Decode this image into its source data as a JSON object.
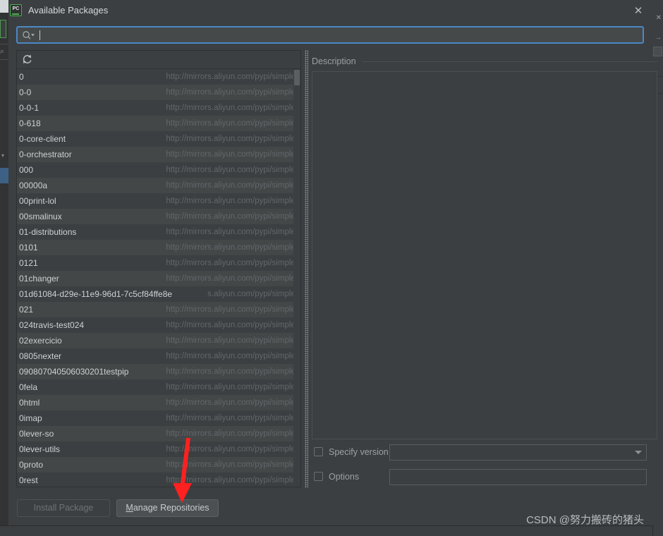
{
  "window": {
    "title": "Available Packages",
    "icon": "pycharm-icon",
    "icon_text": "PC",
    "close_label": "✕",
    "accent_color": "#4a88c7",
    "bg_color": "#3c3f41"
  },
  "search": {
    "value": "",
    "placeholder": "",
    "icon": "search-icon",
    "dropdown_icon": "chevron-down-icon"
  },
  "list": {
    "refresh_icon": "refresh-icon",
    "columns": [
      "name",
      "repository"
    ],
    "rows": [
      {
        "name": "0",
        "url": "http://mirrors.aliyun.com/pypi/simple/"
      },
      {
        "name": "0-0",
        "url": "http://mirrors.aliyun.com/pypi/simple/"
      },
      {
        "name": "0-0-1",
        "url": "http://mirrors.aliyun.com/pypi/simple/"
      },
      {
        "name": "0-618",
        "url": "http://mirrors.aliyun.com/pypi/simple/"
      },
      {
        "name": "0-core-client",
        "url": "http://mirrors.aliyun.com/pypi/simple/"
      },
      {
        "name": "0-orchestrator",
        "url": "http://mirrors.aliyun.com/pypi/simple/"
      },
      {
        "name": "000",
        "url": "http://mirrors.aliyun.com/pypi/simple/"
      },
      {
        "name": "00000a",
        "url": "http://mirrors.aliyun.com/pypi/simple/"
      },
      {
        "name": "00print-lol",
        "url": "http://mirrors.aliyun.com/pypi/simple/"
      },
      {
        "name": "00smalinux",
        "url": "http://mirrors.aliyun.com/pypi/simple/"
      },
      {
        "name": "01-distributions",
        "url": "http://mirrors.aliyun.com/pypi/simple/"
      },
      {
        "name": "0101",
        "url": "http://mirrors.aliyun.com/pypi/simple/"
      },
      {
        "name": "0121",
        "url": "http://mirrors.aliyun.com/pypi/simple/"
      },
      {
        "name": "01changer",
        "url": "http://mirrors.aliyun.com/pypi/simple/"
      },
      {
        "name": "01d61084-d29e-11e9-96d1-7c5cf84ffe8e",
        "url": "s.aliyun.com/pypi/simple/"
      },
      {
        "name": "021",
        "url": "http://mirrors.aliyun.com/pypi/simple/"
      },
      {
        "name": "024travis-test024",
        "url": "http://mirrors.aliyun.com/pypi/simple/"
      },
      {
        "name": "02exercicio",
        "url": "http://mirrors.aliyun.com/pypi/simple/"
      },
      {
        "name": "0805nexter",
        "url": "http://mirrors.aliyun.com/pypi/simple/"
      },
      {
        "name": "090807040506030201testpip",
        "url": "http://mirrors.aliyun.com/pypi/simple/"
      },
      {
        "name": "0fela",
        "url": "http://mirrors.aliyun.com/pypi/simple/"
      },
      {
        "name": "0html",
        "url": "http://mirrors.aliyun.com/pypi/simple/"
      },
      {
        "name": "0imap",
        "url": "http://mirrors.aliyun.com/pypi/simple/"
      },
      {
        "name": "0lever-so",
        "url": "http://mirrors.aliyun.com/pypi/simple/"
      },
      {
        "name": "0lever-utils",
        "url": "http://mirrors.aliyun.com/pypi/simple/"
      },
      {
        "name": "0proto",
        "url": "http://mirrors.aliyun.com/pypi/simple/"
      },
      {
        "name": "0rest",
        "url": "http://mirrors.aliyun.com/pypi/simple/"
      }
    ]
  },
  "description": {
    "title": "Description",
    "content": ""
  },
  "options": {
    "specify_version": {
      "label": "Specify version",
      "checked": false,
      "value": ""
    },
    "options_field": {
      "label": "Options",
      "checked": false,
      "value": ""
    }
  },
  "footer": {
    "install_label": "Install Package",
    "install_enabled": false,
    "manage_label": "Manage Repositories",
    "manage_mnemonic": "M",
    "manage_rest": "anage Repositories"
  },
  "watermark": {
    "text": "CSDN @努力搬砖的猪头"
  },
  "annotation": {
    "arrow_color": "#ff2020",
    "points_to": "manage-repositories-button"
  }
}
